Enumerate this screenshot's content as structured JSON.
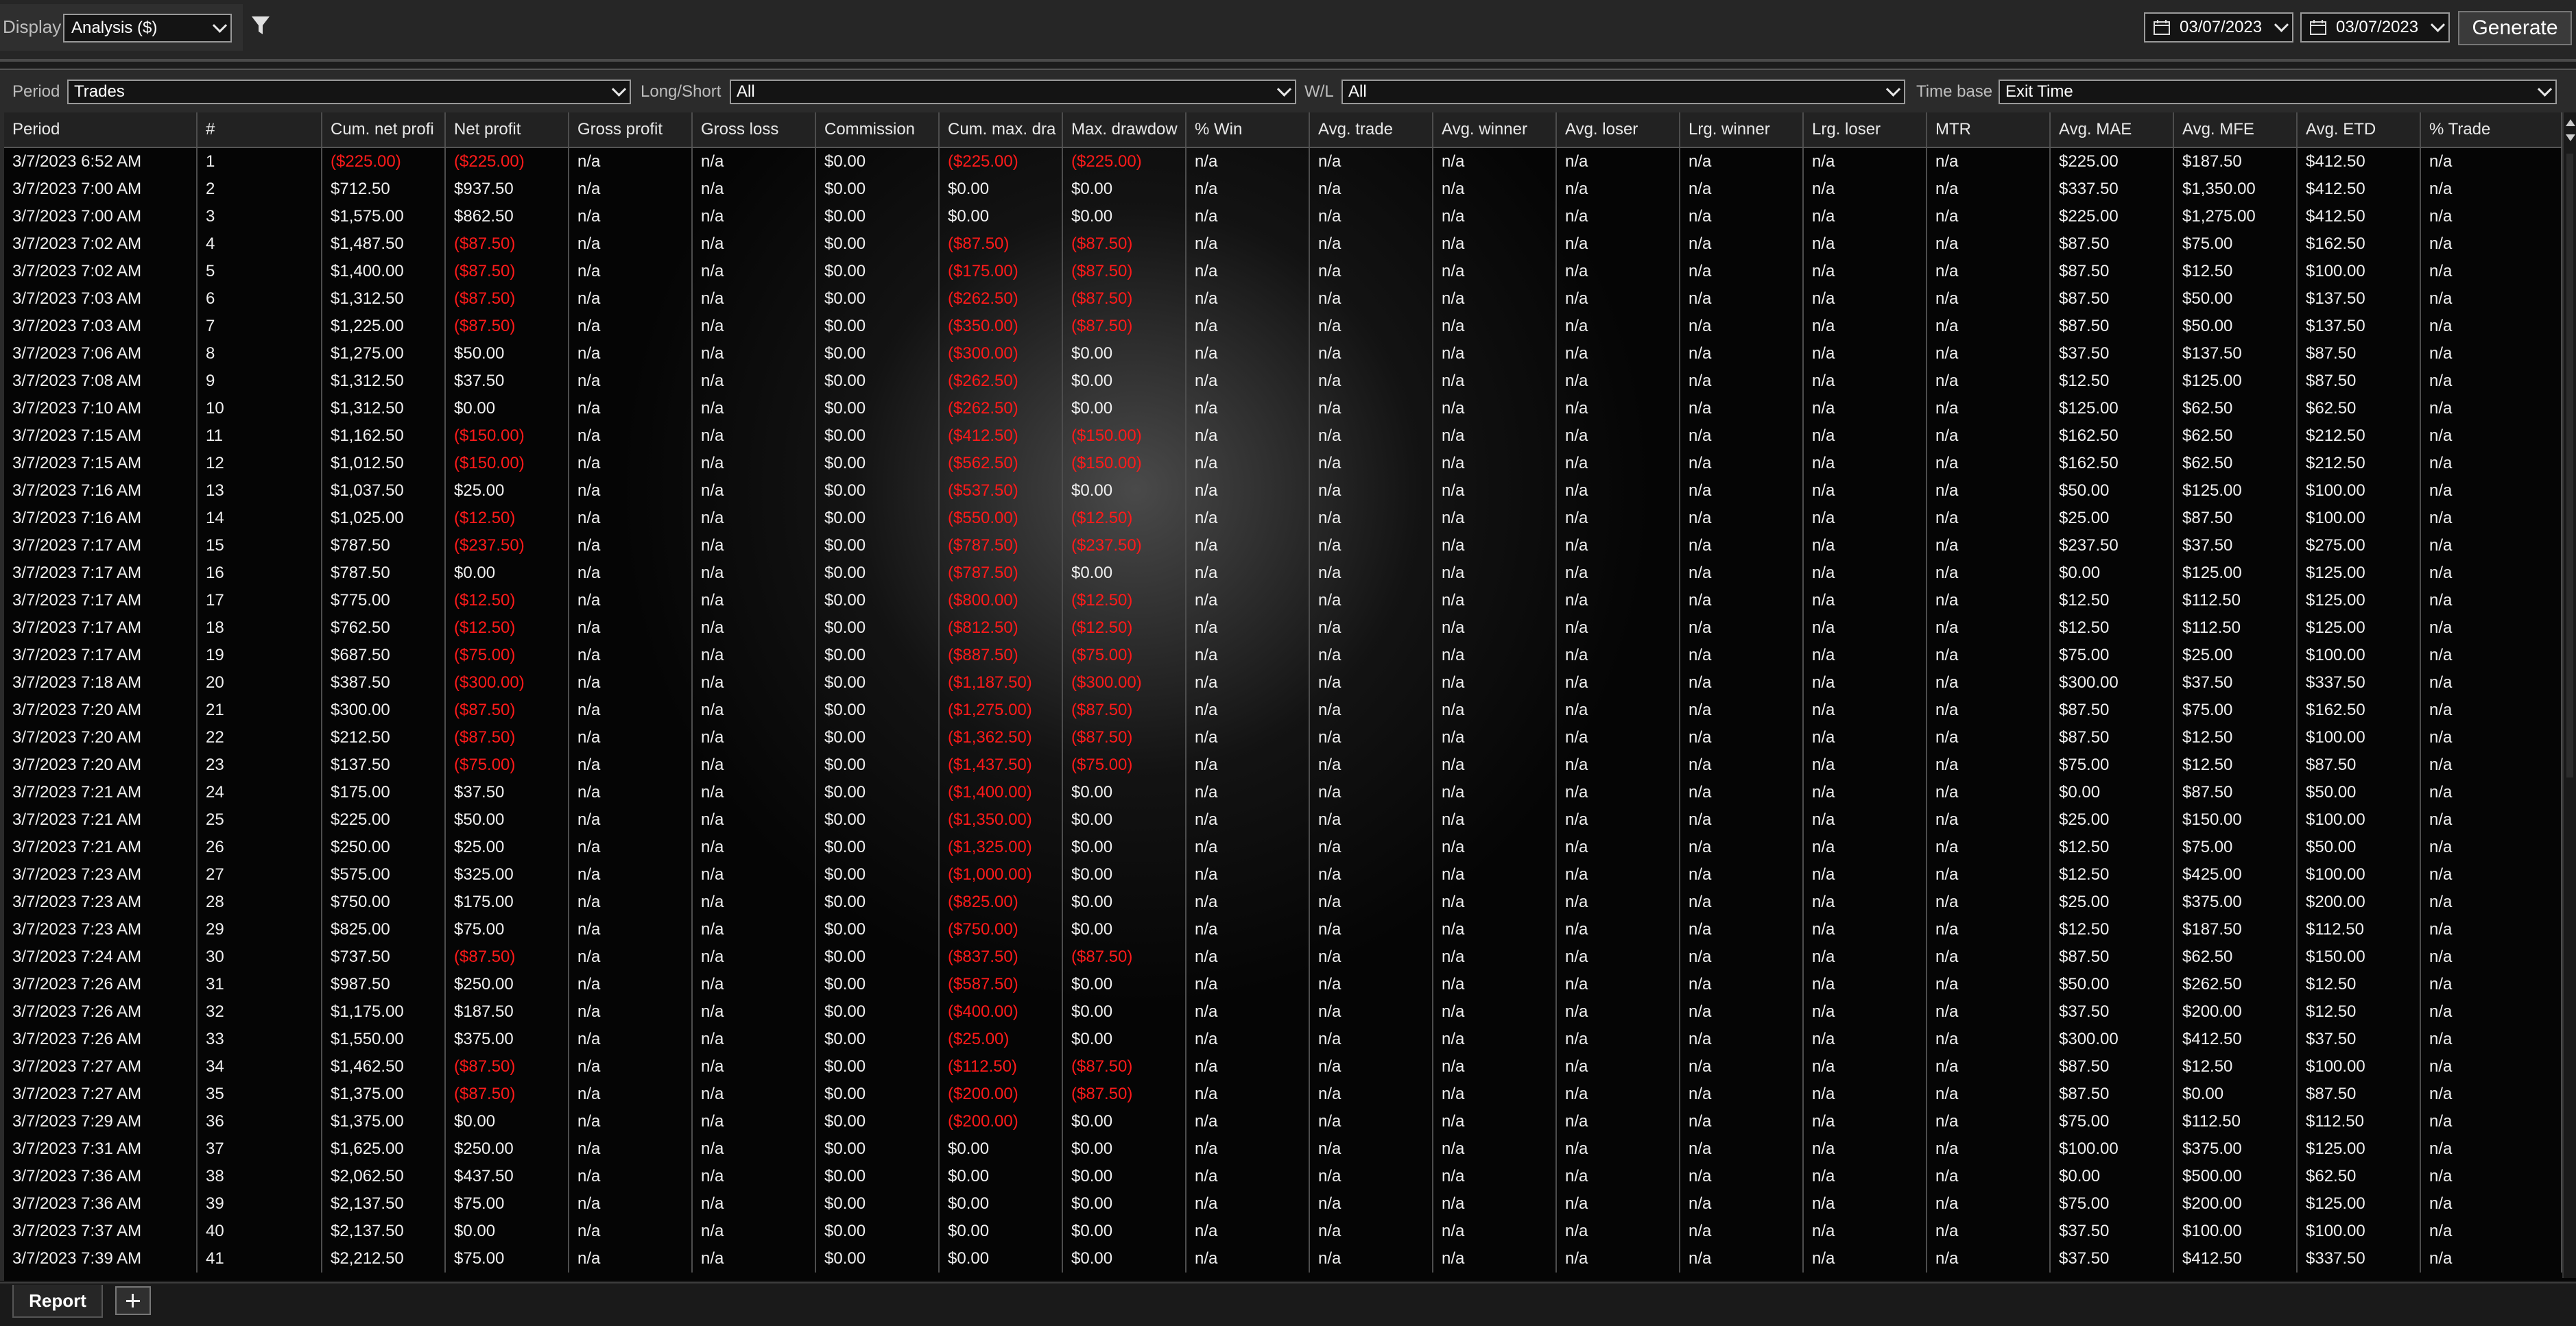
{
  "toolbar": {
    "display_label": "Display",
    "display_value": "Analysis ($)",
    "date_from": "03/07/2023",
    "date_to": "03/07/2023",
    "generate_label": "Generate"
  },
  "filters": {
    "period_label": "Period",
    "period_value": "Trades",
    "longshort_label": "Long/Short",
    "longshort_value": "All",
    "wl_label": "W/L",
    "wl_value": "All",
    "timebase_label": "Time base",
    "timebase_value": "Exit Time"
  },
  "colors": {
    "negative": "#ff1a1a",
    "text": "#f0f0f0",
    "background": "#050505"
  },
  "table": {
    "columns": [
      "Period",
      "#",
      "Cum. net profi",
      "Net profit",
      "Gross profit",
      "Gross loss",
      "Commission",
      "Cum. max. dra",
      "Max. drawdow",
      "% Win",
      "Avg. trade",
      "Avg. winner",
      "Avg. loser",
      "Lrg. winner",
      "Lrg. loser",
      "MTR",
      "Avg. MAE",
      "Avg. MFE",
      "Avg. ETD",
      "% Trade"
    ],
    "rows": [
      [
        "3/7/2023 6:52 AM",
        "1",
        "($225.00)",
        "($225.00)",
        "n/a",
        "n/a",
        "$0.00",
        "($225.00)",
        "($225.00)",
        "n/a",
        "n/a",
        "n/a",
        "n/a",
        "n/a",
        "n/a",
        "n/a",
        "$225.00",
        "$187.50",
        "$412.50",
        "n/a"
      ],
      [
        "3/7/2023 7:00 AM",
        "2",
        "$712.50",
        "$937.50",
        "n/a",
        "n/a",
        "$0.00",
        "$0.00",
        "$0.00",
        "n/a",
        "n/a",
        "n/a",
        "n/a",
        "n/a",
        "n/a",
        "n/a",
        "$337.50",
        "$1,350.00",
        "$412.50",
        "n/a"
      ],
      [
        "3/7/2023 7:00 AM",
        "3",
        "$1,575.00",
        "$862.50",
        "n/a",
        "n/a",
        "$0.00",
        "$0.00",
        "$0.00",
        "n/a",
        "n/a",
        "n/a",
        "n/a",
        "n/a",
        "n/a",
        "n/a",
        "$225.00",
        "$1,275.00",
        "$412.50",
        "n/a"
      ],
      [
        "3/7/2023 7:02 AM",
        "4",
        "$1,487.50",
        "($87.50)",
        "n/a",
        "n/a",
        "$0.00",
        "($87.50)",
        "($87.50)",
        "n/a",
        "n/a",
        "n/a",
        "n/a",
        "n/a",
        "n/a",
        "n/a",
        "$87.50",
        "$75.00",
        "$162.50",
        "n/a"
      ],
      [
        "3/7/2023 7:02 AM",
        "5",
        "$1,400.00",
        "($87.50)",
        "n/a",
        "n/a",
        "$0.00",
        "($175.00)",
        "($87.50)",
        "n/a",
        "n/a",
        "n/a",
        "n/a",
        "n/a",
        "n/a",
        "n/a",
        "$87.50",
        "$12.50",
        "$100.00",
        "n/a"
      ],
      [
        "3/7/2023 7:03 AM",
        "6",
        "$1,312.50",
        "($87.50)",
        "n/a",
        "n/a",
        "$0.00",
        "($262.50)",
        "($87.50)",
        "n/a",
        "n/a",
        "n/a",
        "n/a",
        "n/a",
        "n/a",
        "n/a",
        "$87.50",
        "$50.00",
        "$137.50",
        "n/a"
      ],
      [
        "3/7/2023 7:03 AM",
        "7",
        "$1,225.00",
        "($87.50)",
        "n/a",
        "n/a",
        "$0.00",
        "($350.00)",
        "($87.50)",
        "n/a",
        "n/a",
        "n/a",
        "n/a",
        "n/a",
        "n/a",
        "n/a",
        "$87.50",
        "$50.00",
        "$137.50",
        "n/a"
      ],
      [
        "3/7/2023 7:06 AM",
        "8",
        "$1,275.00",
        "$50.00",
        "n/a",
        "n/a",
        "$0.00",
        "($300.00)",
        "$0.00",
        "n/a",
        "n/a",
        "n/a",
        "n/a",
        "n/a",
        "n/a",
        "n/a",
        "$37.50",
        "$137.50",
        "$87.50",
        "n/a"
      ],
      [
        "3/7/2023 7:08 AM",
        "9",
        "$1,312.50",
        "$37.50",
        "n/a",
        "n/a",
        "$0.00",
        "($262.50)",
        "$0.00",
        "n/a",
        "n/a",
        "n/a",
        "n/a",
        "n/a",
        "n/a",
        "n/a",
        "$12.50",
        "$125.00",
        "$87.50",
        "n/a"
      ],
      [
        "3/7/2023 7:10 AM",
        "10",
        "$1,312.50",
        "$0.00",
        "n/a",
        "n/a",
        "$0.00",
        "($262.50)",
        "$0.00",
        "n/a",
        "n/a",
        "n/a",
        "n/a",
        "n/a",
        "n/a",
        "n/a",
        "$125.00",
        "$62.50",
        "$62.50",
        "n/a"
      ],
      [
        "3/7/2023 7:15 AM",
        "11",
        "$1,162.50",
        "($150.00)",
        "n/a",
        "n/a",
        "$0.00",
        "($412.50)",
        "($150.00)",
        "n/a",
        "n/a",
        "n/a",
        "n/a",
        "n/a",
        "n/a",
        "n/a",
        "$162.50",
        "$62.50",
        "$212.50",
        "n/a"
      ],
      [
        "3/7/2023 7:15 AM",
        "12",
        "$1,012.50",
        "($150.00)",
        "n/a",
        "n/a",
        "$0.00",
        "($562.50)",
        "($150.00)",
        "n/a",
        "n/a",
        "n/a",
        "n/a",
        "n/a",
        "n/a",
        "n/a",
        "$162.50",
        "$62.50",
        "$212.50",
        "n/a"
      ],
      [
        "3/7/2023 7:16 AM",
        "13",
        "$1,037.50",
        "$25.00",
        "n/a",
        "n/a",
        "$0.00",
        "($537.50)",
        "$0.00",
        "n/a",
        "n/a",
        "n/a",
        "n/a",
        "n/a",
        "n/a",
        "n/a",
        "$50.00",
        "$125.00",
        "$100.00",
        "n/a"
      ],
      [
        "3/7/2023 7:16 AM",
        "14",
        "$1,025.00",
        "($12.50)",
        "n/a",
        "n/a",
        "$0.00",
        "($550.00)",
        "($12.50)",
        "n/a",
        "n/a",
        "n/a",
        "n/a",
        "n/a",
        "n/a",
        "n/a",
        "$25.00",
        "$87.50",
        "$100.00",
        "n/a"
      ],
      [
        "3/7/2023 7:17 AM",
        "15",
        "$787.50",
        "($237.50)",
        "n/a",
        "n/a",
        "$0.00",
        "($787.50)",
        "($237.50)",
        "n/a",
        "n/a",
        "n/a",
        "n/a",
        "n/a",
        "n/a",
        "n/a",
        "$237.50",
        "$37.50",
        "$275.00",
        "n/a"
      ],
      [
        "3/7/2023 7:17 AM",
        "16",
        "$787.50",
        "$0.00",
        "n/a",
        "n/a",
        "$0.00",
        "($787.50)",
        "$0.00",
        "n/a",
        "n/a",
        "n/a",
        "n/a",
        "n/a",
        "n/a",
        "n/a",
        "$0.00",
        "$125.00",
        "$125.00",
        "n/a"
      ],
      [
        "3/7/2023 7:17 AM",
        "17",
        "$775.00",
        "($12.50)",
        "n/a",
        "n/a",
        "$0.00",
        "($800.00)",
        "($12.50)",
        "n/a",
        "n/a",
        "n/a",
        "n/a",
        "n/a",
        "n/a",
        "n/a",
        "$12.50",
        "$112.50",
        "$125.00",
        "n/a"
      ],
      [
        "3/7/2023 7:17 AM",
        "18",
        "$762.50",
        "($12.50)",
        "n/a",
        "n/a",
        "$0.00",
        "($812.50)",
        "($12.50)",
        "n/a",
        "n/a",
        "n/a",
        "n/a",
        "n/a",
        "n/a",
        "n/a",
        "$12.50",
        "$112.50",
        "$125.00",
        "n/a"
      ],
      [
        "3/7/2023 7:17 AM",
        "19",
        "$687.50",
        "($75.00)",
        "n/a",
        "n/a",
        "$0.00",
        "($887.50)",
        "($75.00)",
        "n/a",
        "n/a",
        "n/a",
        "n/a",
        "n/a",
        "n/a",
        "n/a",
        "$75.00",
        "$25.00",
        "$100.00",
        "n/a"
      ],
      [
        "3/7/2023 7:18 AM",
        "20",
        "$387.50",
        "($300.00)",
        "n/a",
        "n/a",
        "$0.00",
        "($1,187.50)",
        "($300.00)",
        "n/a",
        "n/a",
        "n/a",
        "n/a",
        "n/a",
        "n/a",
        "n/a",
        "$300.00",
        "$37.50",
        "$337.50",
        "n/a"
      ],
      [
        "3/7/2023 7:20 AM",
        "21",
        "$300.00",
        "($87.50)",
        "n/a",
        "n/a",
        "$0.00",
        "($1,275.00)",
        "($87.50)",
        "n/a",
        "n/a",
        "n/a",
        "n/a",
        "n/a",
        "n/a",
        "n/a",
        "$87.50",
        "$75.00",
        "$162.50",
        "n/a"
      ],
      [
        "3/7/2023 7:20 AM",
        "22",
        "$212.50",
        "($87.50)",
        "n/a",
        "n/a",
        "$0.00",
        "($1,362.50)",
        "($87.50)",
        "n/a",
        "n/a",
        "n/a",
        "n/a",
        "n/a",
        "n/a",
        "n/a",
        "$87.50",
        "$12.50",
        "$100.00",
        "n/a"
      ],
      [
        "3/7/2023 7:20 AM",
        "23",
        "$137.50",
        "($75.00)",
        "n/a",
        "n/a",
        "$0.00",
        "($1,437.50)",
        "($75.00)",
        "n/a",
        "n/a",
        "n/a",
        "n/a",
        "n/a",
        "n/a",
        "n/a",
        "$75.00",
        "$12.50",
        "$87.50",
        "n/a"
      ],
      [
        "3/7/2023 7:21 AM",
        "24",
        "$175.00",
        "$37.50",
        "n/a",
        "n/a",
        "$0.00",
        "($1,400.00)",
        "$0.00",
        "n/a",
        "n/a",
        "n/a",
        "n/a",
        "n/a",
        "n/a",
        "n/a",
        "$0.00",
        "$87.50",
        "$50.00",
        "n/a"
      ],
      [
        "3/7/2023 7:21 AM",
        "25",
        "$225.00",
        "$50.00",
        "n/a",
        "n/a",
        "$0.00",
        "($1,350.00)",
        "$0.00",
        "n/a",
        "n/a",
        "n/a",
        "n/a",
        "n/a",
        "n/a",
        "n/a",
        "$25.00",
        "$150.00",
        "$100.00",
        "n/a"
      ],
      [
        "3/7/2023 7:21 AM",
        "26",
        "$250.00",
        "$25.00",
        "n/a",
        "n/a",
        "$0.00",
        "($1,325.00)",
        "$0.00",
        "n/a",
        "n/a",
        "n/a",
        "n/a",
        "n/a",
        "n/a",
        "n/a",
        "$12.50",
        "$75.00",
        "$50.00",
        "n/a"
      ],
      [
        "3/7/2023 7:23 AM",
        "27",
        "$575.00",
        "$325.00",
        "n/a",
        "n/a",
        "$0.00",
        "($1,000.00)",
        "$0.00",
        "n/a",
        "n/a",
        "n/a",
        "n/a",
        "n/a",
        "n/a",
        "n/a",
        "$12.50",
        "$425.00",
        "$100.00",
        "n/a"
      ],
      [
        "3/7/2023 7:23 AM",
        "28",
        "$750.00",
        "$175.00",
        "n/a",
        "n/a",
        "$0.00",
        "($825.00)",
        "$0.00",
        "n/a",
        "n/a",
        "n/a",
        "n/a",
        "n/a",
        "n/a",
        "n/a",
        "$25.00",
        "$375.00",
        "$200.00",
        "n/a"
      ],
      [
        "3/7/2023 7:23 AM",
        "29",
        "$825.00",
        "$75.00",
        "n/a",
        "n/a",
        "$0.00",
        "($750.00)",
        "$0.00",
        "n/a",
        "n/a",
        "n/a",
        "n/a",
        "n/a",
        "n/a",
        "n/a",
        "$12.50",
        "$187.50",
        "$112.50",
        "n/a"
      ],
      [
        "3/7/2023 7:24 AM",
        "30",
        "$737.50",
        "($87.50)",
        "n/a",
        "n/a",
        "$0.00",
        "($837.50)",
        "($87.50)",
        "n/a",
        "n/a",
        "n/a",
        "n/a",
        "n/a",
        "n/a",
        "n/a",
        "$87.50",
        "$62.50",
        "$150.00",
        "n/a"
      ],
      [
        "3/7/2023 7:26 AM",
        "31",
        "$987.50",
        "$250.00",
        "n/a",
        "n/a",
        "$0.00",
        "($587.50)",
        "$0.00",
        "n/a",
        "n/a",
        "n/a",
        "n/a",
        "n/a",
        "n/a",
        "n/a",
        "$50.00",
        "$262.50",
        "$12.50",
        "n/a"
      ],
      [
        "3/7/2023 7:26 AM",
        "32",
        "$1,175.00",
        "$187.50",
        "n/a",
        "n/a",
        "$0.00",
        "($400.00)",
        "$0.00",
        "n/a",
        "n/a",
        "n/a",
        "n/a",
        "n/a",
        "n/a",
        "n/a",
        "$37.50",
        "$200.00",
        "$12.50",
        "n/a"
      ],
      [
        "3/7/2023 7:26 AM",
        "33",
        "$1,550.00",
        "$375.00",
        "n/a",
        "n/a",
        "$0.00",
        "($25.00)",
        "$0.00",
        "n/a",
        "n/a",
        "n/a",
        "n/a",
        "n/a",
        "n/a",
        "n/a",
        "$300.00",
        "$412.50",
        "$37.50",
        "n/a"
      ],
      [
        "3/7/2023 7:27 AM",
        "34",
        "$1,462.50",
        "($87.50)",
        "n/a",
        "n/a",
        "$0.00",
        "($112.50)",
        "($87.50)",
        "n/a",
        "n/a",
        "n/a",
        "n/a",
        "n/a",
        "n/a",
        "n/a",
        "$87.50",
        "$12.50",
        "$100.00",
        "n/a"
      ],
      [
        "3/7/2023 7:27 AM",
        "35",
        "$1,375.00",
        "($87.50)",
        "n/a",
        "n/a",
        "$0.00",
        "($200.00)",
        "($87.50)",
        "n/a",
        "n/a",
        "n/a",
        "n/a",
        "n/a",
        "n/a",
        "n/a",
        "$87.50",
        "$0.00",
        "$87.50",
        "n/a"
      ],
      [
        "3/7/2023 7:29 AM",
        "36",
        "$1,375.00",
        "$0.00",
        "n/a",
        "n/a",
        "$0.00",
        "($200.00)",
        "$0.00",
        "n/a",
        "n/a",
        "n/a",
        "n/a",
        "n/a",
        "n/a",
        "n/a",
        "$75.00",
        "$112.50",
        "$112.50",
        "n/a"
      ],
      [
        "3/7/2023 7:31 AM",
        "37",
        "$1,625.00",
        "$250.00",
        "n/a",
        "n/a",
        "$0.00",
        "$0.00",
        "$0.00",
        "n/a",
        "n/a",
        "n/a",
        "n/a",
        "n/a",
        "n/a",
        "n/a",
        "$100.00",
        "$375.00",
        "$125.00",
        "n/a"
      ],
      [
        "3/7/2023 7:36 AM",
        "38",
        "$2,062.50",
        "$437.50",
        "n/a",
        "n/a",
        "$0.00",
        "$0.00",
        "$0.00",
        "n/a",
        "n/a",
        "n/a",
        "n/a",
        "n/a",
        "n/a",
        "n/a",
        "$0.00",
        "$500.00",
        "$62.50",
        "n/a"
      ],
      [
        "3/7/2023 7:36 AM",
        "39",
        "$2,137.50",
        "$75.00",
        "n/a",
        "n/a",
        "$0.00",
        "$0.00",
        "$0.00",
        "n/a",
        "n/a",
        "n/a",
        "n/a",
        "n/a",
        "n/a",
        "n/a",
        "$75.00",
        "$200.00",
        "$125.00",
        "n/a"
      ],
      [
        "3/7/2023 7:37 AM",
        "40",
        "$2,137.50",
        "$0.00",
        "n/a",
        "n/a",
        "$0.00",
        "$0.00",
        "$0.00",
        "n/a",
        "n/a",
        "n/a",
        "n/a",
        "n/a",
        "n/a",
        "n/a",
        "$37.50",
        "$100.00",
        "$100.00",
        "n/a"
      ],
      [
        "3/7/2023 7:39 AM",
        "41",
        "$2,212.50",
        "$75.00",
        "n/a",
        "n/a",
        "$0.00",
        "$0.00",
        "$0.00",
        "n/a",
        "n/a",
        "n/a",
        "n/a",
        "n/a",
        "n/a",
        "n/a",
        "$37.50",
        "$412.50",
        "$337.50",
        "n/a"
      ]
    ]
  },
  "tabs": {
    "report_label": "Report"
  }
}
